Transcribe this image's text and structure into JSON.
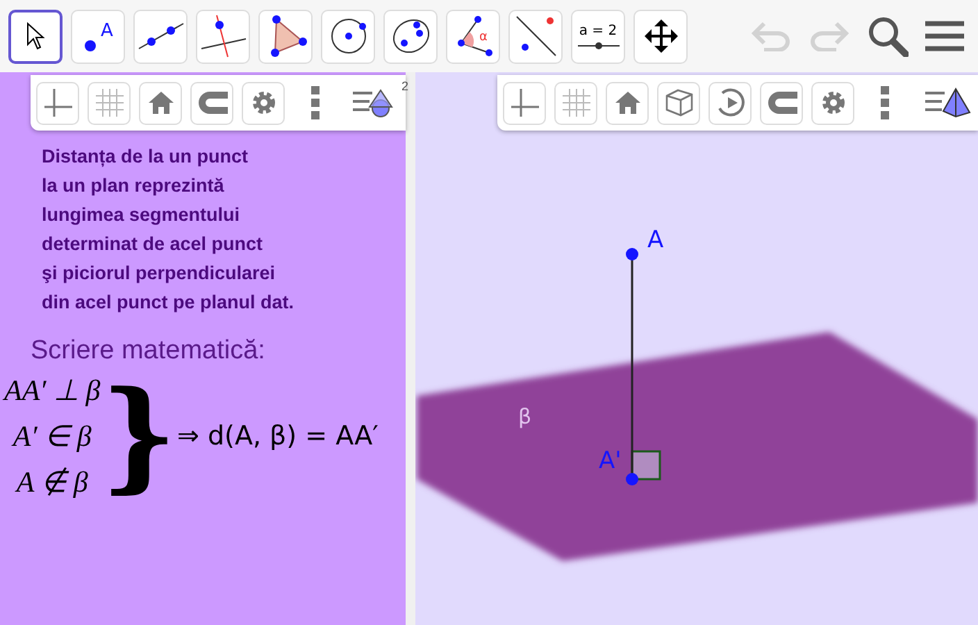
{
  "toolbar": {
    "tools": [
      {
        "kind": "move",
        "selected": true
      },
      {
        "kind": "point",
        "label": "A",
        "selected": false
      },
      {
        "kind": "line",
        "selected": false
      },
      {
        "kind": "perpendicular",
        "selected": false
      },
      {
        "kind": "polygon",
        "selected": false
      },
      {
        "kind": "circle",
        "selected": false
      },
      {
        "kind": "ellipse",
        "selected": false
      },
      {
        "kind": "angle",
        "label": "α",
        "selected": false
      },
      {
        "kind": "reflect",
        "selected": false
      },
      {
        "kind": "slider",
        "label": "a = 2",
        "selected": false
      },
      {
        "kind": "pan",
        "selected": false
      }
    ],
    "undo": {
      "disabled": true
    },
    "redo": {
      "disabled": true
    }
  },
  "graphics_style_bar": {
    "buttons": [
      {
        "kind": "axes"
      },
      {
        "kind": "grid"
      },
      {
        "kind": "home"
      },
      {
        "kind": "magnet"
      },
      {
        "kind": "gear"
      },
      {
        "kind": "more"
      },
      {
        "kind": "view2d",
        "badge": "2"
      }
    ]
  },
  "view3d_style_bar": {
    "buttons": [
      {
        "kind": "axes"
      },
      {
        "kind": "grid"
      },
      {
        "kind": "home"
      },
      {
        "kind": "cube"
      },
      {
        "kind": "rotate"
      },
      {
        "kind": "magnet"
      },
      {
        "kind": "gear"
      },
      {
        "kind": "more"
      },
      {
        "kind": "view3d"
      }
    ]
  },
  "definition": {
    "lines": [
      "Distanța de la un punct",
      "la un plan reprezintă",
      "lungimea segmentului",
      "determinat de acel punct",
      "şi piciorul perpendicularei",
      "din acel punct pe planul dat."
    ]
  },
  "math": {
    "heading": "Scriere matematică:",
    "conditions": [
      "AA′ ⊥ β",
      "A′ ∈ β",
      "A ∉ β"
    ],
    "brace": "}",
    "conclusion": "⇒ d(A, β) = AA′"
  },
  "view3d": {
    "plane": {
      "label": "β"
    },
    "points": [
      {
        "label": "A"
      },
      {
        "label": "A'"
      }
    ]
  }
}
